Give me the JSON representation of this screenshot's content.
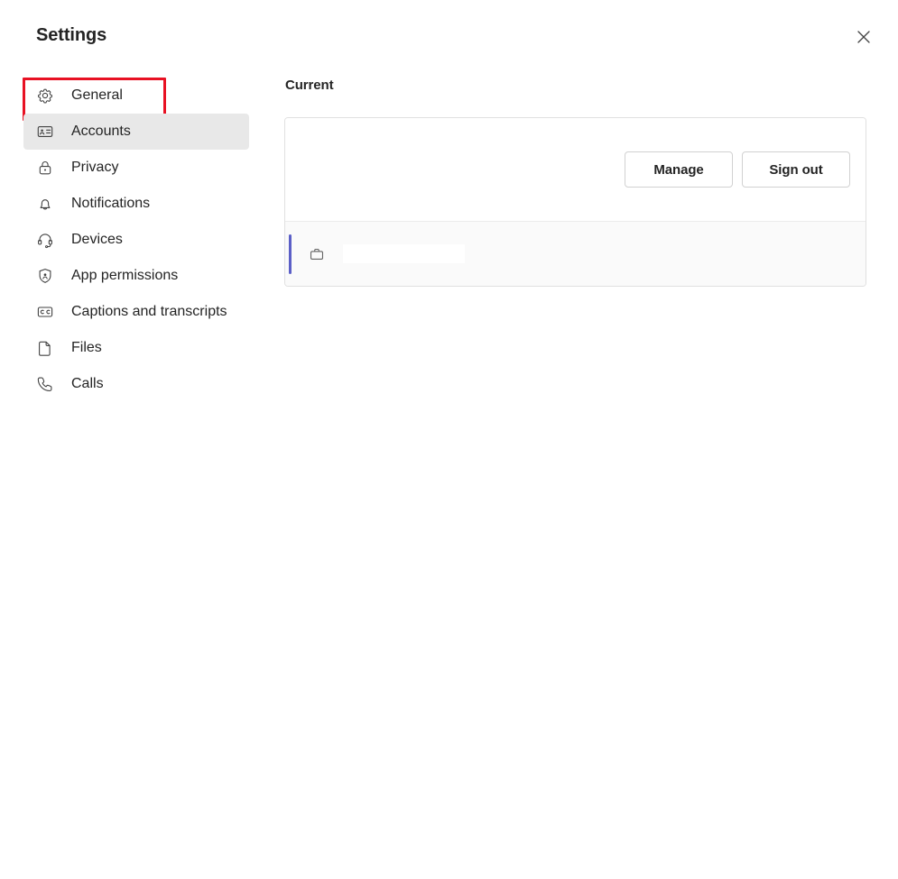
{
  "window": {
    "title": "Settings",
    "close_label": "Close",
    "close_icon": "close-icon"
  },
  "sidebar": {
    "items": [
      {
        "id": "general",
        "label": "General",
        "icon": "gear-icon",
        "selected": false,
        "annotated": true
      },
      {
        "id": "accounts",
        "label": "Accounts",
        "icon": "contact-card-icon",
        "selected": true,
        "annotated": false
      },
      {
        "id": "privacy",
        "label": "Privacy",
        "icon": "lock-icon",
        "selected": false,
        "annotated": false
      },
      {
        "id": "notifications",
        "label": "Notifications",
        "icon": "bell-icon",
        "selected": false,
        "annotated": false
      },
      {
        "id": "devices",
        "label": "Devices",
        "icon": "headset-icon",
        "selected": false,
        "annotated": false
      },
      {
        "id": "app-permissions",
        "label": "App permissions",
        "icon": "shield-person-icon",
        "selected": false,
        "annotated": false
      },
      {
        "id": "captions",
        "label": "Captions and transcripts",
        "icon": "closed-caption-icon",
        "selected": false,
        "annotated": false
      },
      {
        "id": "files",
        "label": "Files",
        "icon": "document-icon",
        "selected": false,
        "annotated": false
      },
      {
        "id": "calls",
        "label": "Calls",
        "icon": "phone-icon",
        "selected": false,
        "annotated": false
      }
    ]
  },
  "main": {
    "section_heading": "Current",
    "card": {
      "manage_label": "Manage",
      "sign_out_label": "Sign out",
      "org_icon": "briefcase-icon",
      "org_name": "",
      "accent_color": "#5b5fc7"
    }
  },
  "annotation": {
    "color": "#e81123",
    "target": "general"
  }
}
